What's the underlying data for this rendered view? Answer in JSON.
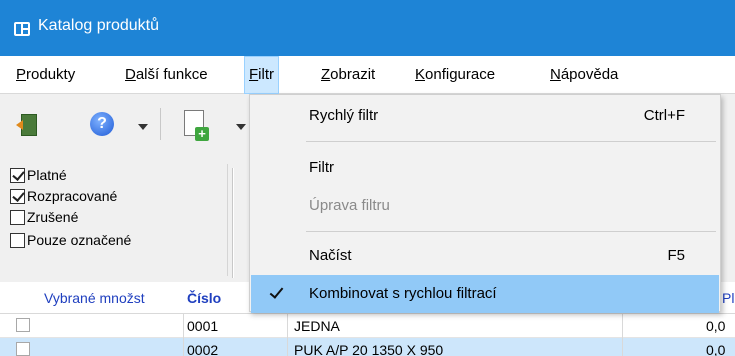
{
  "window": {
    "title": "Katalog produktů"
  },
  "menubar": {
    "items": [
      "Produkty",
      "Další funkce",
      "Filtr",
      "Zobrazit",
      "Konfigurace",
      "Nápověda"
    ]
  },
  "filter_panel": {
    "checkboxes": [
      {
        "label": "Platné",
        "checked": true
      },
      {
        "label": "Rozpracované",
        "checked": true
      },
      {
        "label": "Zrušené",
        "checked": false
      },
      {
        "label": "Pouze označené",
        "checked": false
      }
    ]
  },
  "grid": {
    "columns": [
      "Vybrané množst",
      "Číslo",
      "Pl"
    ],
    "rows": [
      {
        "cislo": "0001",
        "nazev": "JEDNA",
        "value": "0,0"
      },
      {
        "cislo": "0002",
        "nazev": "PUK A/P 20 1350 X 950",
        "value": "0,0"
      }
    ]
  },
  "filter_menu": {
    "items": [
      {
        "label": "Rychlý filtr",
        "shortcut": "Ctrl+F"
      },
      {
        "label": "Filtr",
        "shortcut": ""
      },
      {
        "label": "Úprava filtru",
        "shortcut": "",
        "disabled": true
      },
      {
        "label": "Načíst",
        "shortcut": "F5"
      },
      {
        "label": "Kombinovat s rychlou filtrací",
        "shortcut": "",
        "checked": true
      }
    ]
  },
  "colors": {
    "titlebar": "#1e84d6",
    "menu_highlight": "#91c9f7",
    "header_text": "#1f3fbf"
  }
}
